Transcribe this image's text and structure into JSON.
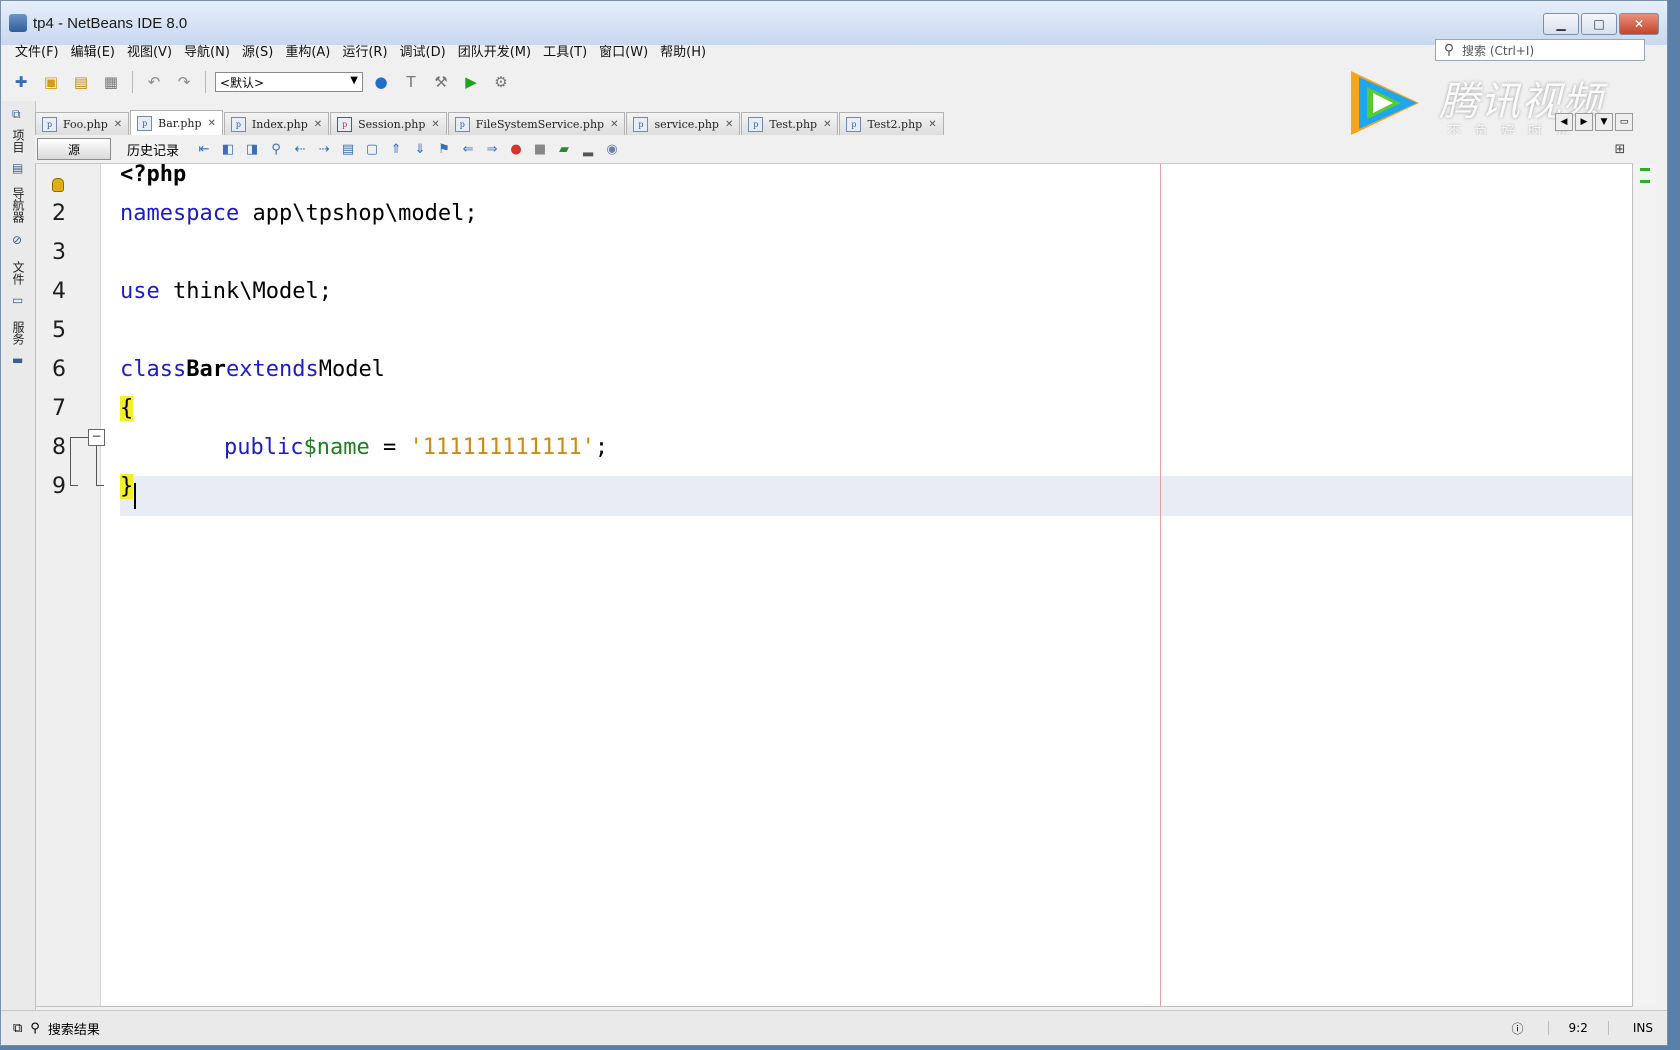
{
  "window": {
    "title": "tp4 - NetBeans IDE 8.0"
  },
  "menu": [
    "文件(F)",
    "编辑(E)",
    "视图(V)",
    "导航(N)",
    "源(S)",
    "重构(A)",
    "运行(R)",
    "调试(D)",
    "团队开发(M)",
    "工具(T)",
    "窗口(W)",
    "帮助(H)"
  ],
  "search": {
    "placeholder": "搜索 (Ctrl+I)"
  },
  "toolbar": {
    "config_value": "<默认>"
  },
  "left_dock": [
    "项目",
    "导航器",
    "文件",
    "服务"
  ],
  "tabs": [
    {
      "label": "Foo.php",
      "active": false
    },
    {
      "label": "Bar.php",
      "active": true
    },
    {
      "label": "Index.php",
      "active": false
    },
    {
      "label": "Session.php",
      "active": false
    },
    {
      "label": "FileSystemService.php",
      "active": false
    },
    {
      "label": "service.php",
      "active": false
    },
    {
      "label": "Test.php",
      "active": false
    },
    {
      "label": "Test2.php",
      "active": false
    }
  ],
  "editor_toolbar": {
    "source_label": "源",
    "history_label": "历史记录"
  },
  "code": {
    "lines": [
      {
        "n": "",
        "text": "<?php"
      },
      {
        "n": "2",
        "kw1": "namespace",
        "rest": " app\\tpshop\\model;"
      },
      {
        "n": "3"
      },
      {
        "n": "4",
        "kw1": "use",
        "rest": " think\\Model;"
      },
      {
        "n": "5"
      },
      {
        "n": "6",
        "kw1": "class",
        "name": "Bar",
        "kw2": "extends",
        "rest": "Model"
      },
      {
        "n": "7",
        "text": "{"
      },
      {
        "n": "8",
        "kw1": "public",
        "var": "$name",
        "eq": " = ",
        "str": "'111111111111'",
        "end": ";"
      },
      {
        "n": "9",
        "text": "}"
      }
    ]
  },
  "status": {
    "search_results": "搜索结果",
    "position": "9:2",
    "mode": "INS"
  },
  "watermark": {
    "brand": "腾讯视频",
    "slogan": "不负好时光"
  }
}
